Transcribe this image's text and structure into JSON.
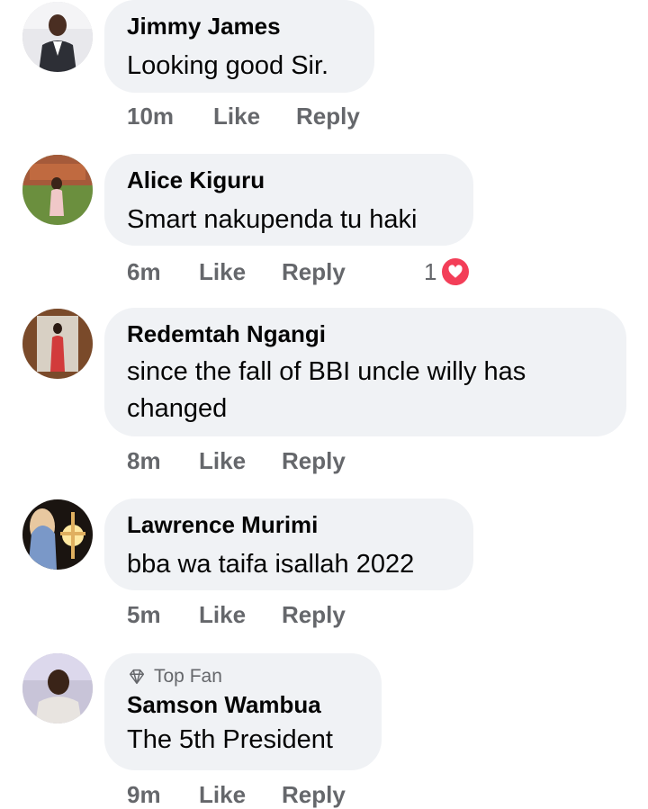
{
  "comments": [
    {
      "name": "Jimmy James",
      "text": "Looking good Sir.",
      "time": "10m",
      "like": "Like",
      "reply": "Reply"
    },
    {
      "name": "Alice Kiguru",
      "text": "Smart nakupenda tu haki",
      "time": "6m",
      "like": "Like",
      "reply": "Reply",
      "reaction_count": "1",
      "reaction_icon": "heart-icon"
    },
    {
      "name": "Redemtah Ngangi",
      "text": "since the fall of BBI uncle willy has changed",
      "time": "8m",
      "like": "Like",
      "reply": "Reply"
    },
    {
      "name": "Lawrence Murimi",
      "text": "bba wa taifa isallah 2022",
      "time": "5m",
      "like": "Like",
      "reply": "Reply"
    },
    {
      "name": "Samson Wambua",
      "badge": "Top Fan",
      "badge_icon": "diamond-icon",
      "text": "The 5th President",
      "time": "9m",
      "like": "Like",
      "reply": "Reply"
    }
  ],
  "colors": {
    "bubble": "#f0f2f5",
    "meta": "#65676b",
    "heart": "#f33e58"
  }
}
